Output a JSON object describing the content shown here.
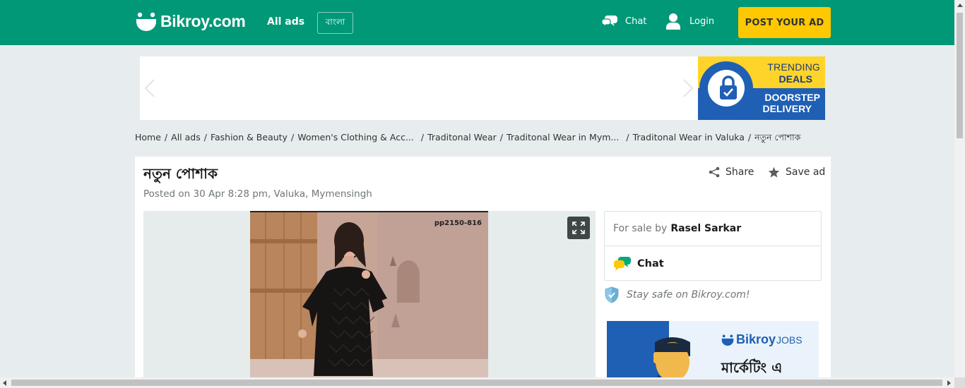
{
  "colors": {
    "brand": "#009877",
    "accent": "#ffc800",
    "promo_blue": "#1f5fb4",
    "promo_yellow": "#ffd42a"
  },
  "header": {
    "logo_text": "Bikroy.com",
    "all_ads": "All ads",
    "language": "বাংলা",
    "chat": "Chat",
    "login": "Login",
    "post_ad": "POST YOUR AD",
    "icons": [
      "logo-face-icon",
      "chat-bubbles-icon",
      "user-icon"
    ]
  },
  "banner": {
    "promo_line1": "TRENDING",
    "promo_line2": "DEALS",
    "promo_line3": "DOORSTEP",
    "promo_line4": "DELIVERY",
    "icons": [
      "chevron-left-icon",
      "chevron-right-icon",
      "lock-icon"
    ]
  },
  "breadcrumb": {
    "items": [
      "Home",
      "All ads",
      "Fashion & Beauty",
      "Women's Clothing & Acc...",
      "Traditonal Wear",
      "Traditonal Wear in Mym...",
      "Traditonal Wear in Valuka",
      "নতুন পোশাক"
    ]
  },
  "ad": {
    "title": "নতুন পোশাক",
    "posted": "Posted on 30 Apr 8:28 pm, Valuka, Mymensingh",
    "share": "Share",
    "save": "Save ad",
    "photo_code": "pp2150-816"
  },
  "seller": {
    "for_sale_by": "For sale by",
    "name": "Rasel Sarkar",
    "chat": "Chat",
    "stay_safe": "Stay safe on Bikroy.com!"
  },
  "jobs_ad": {
    "brand": "Bikroy",
    "brand_suffix": "JOBS",
    "text": "মার্কেটিং এ"
  }
}
